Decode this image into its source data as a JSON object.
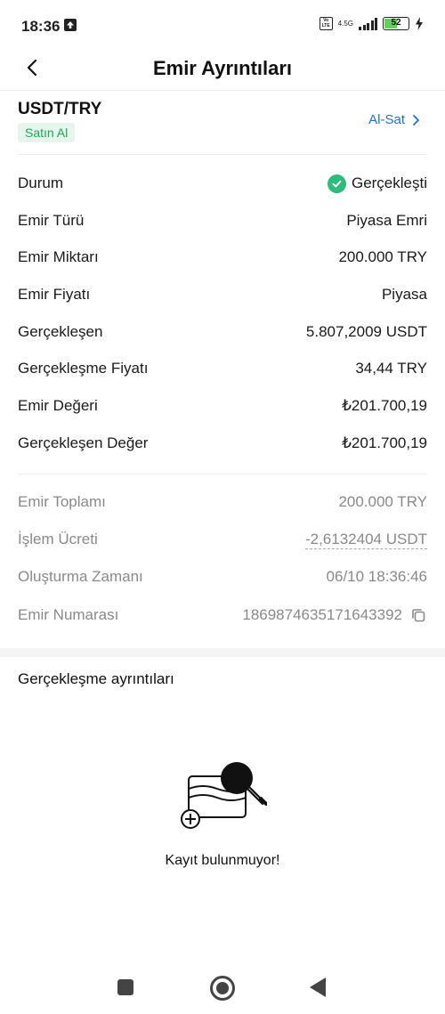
{
  "status_bar": {
    "time": "18:36",
    "volte": "Vo LTE",
    "network": "4.5G",
    "battery": "52"
  },
  "header": {
    "title": "Emir Ayrıntıları"
  },
  "pair": {
    "name": "USDT/TRY",
    "side": "Satın Al",
    "trade_link": "Al-Sat"
  },
  "details": {
    "status_label": "Durum",
    "status_value": "Gerçekleşti",
    "order_type_label": "Emir Türü",
    "order_type_value": "Piyasa Emri",
    "amount_label": "Emir Miktarı",
    "amount_value": "200.000 TRY",
    "price_label": "Emir Fiyatı",
    "price_value": "Piyasa",
    "filled_label": "Gerçekleşen",
    "filled_value": "5.807,2009 USDT",
    "filled_price_label": "Gerçekleşme Fiyatı",
    "filled_price_value": "34,44 TRY",
    "order_value_label": "Emir Değeri",
    "order_value_value": "₺201.700,19",
    "filled_value_label": "Gerçekleşen Değer",
    "filled_value_value": "₺201.700,19"
  },
  "summary": {
    "total_label": "Emir Toplamı",
    "total_value": "200.000 TRY",
    "fee_label": "İşlem Ücreti",
    "fee_value": "-2,6132404 USDT",
    "created_label": "Oluşturma Zamanı",
    "created_value": "06/10 18:36:46",
    "order_no_label": "Emir Numarası",
    "order_no_value": "1869874635171643392"
  },
  "executions": {
    "title": "Gerçekleşme ayrıntıları",
    "empty_text": "Kayıt bulunmuyor!"
  },
  "colors": {
    "accent_green": "#2dbd7a",
    "link_blue": "#1f72d3",
    "muted_text": "#8a8a8a"
  },
  "icons": {
    "back": "chevron-left-icon",
    "trade": "chevron-right-icon",
    "status": "check-circle-icon",
    "copy": "copy-icon",
    "empty": "empty-wallet-search-icon"
  }
}
